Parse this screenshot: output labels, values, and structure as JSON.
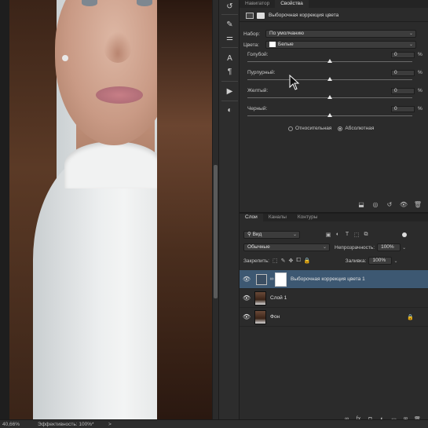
{
  "status_bar": {
    "zoom": "40,66%",
    "efficiency": "Эффективность: 100%*",
    "arrow": ">"
  },
  "tools": [
    {
      "icon": "history-icon",
      "glyph": "↺"
    },
    {
      "icon": "brush-icon",
      "glyph": "✎"
    },
    {
      "icon": "sliders-icon",
      "glyph": "⚌"
    },
    {
      "icon": "type-icon",
      "glyph": "A"
    },
    {
      "icon": "paragraph-icon",
      "glyph": "¶"
    },
    {
      "icon": "play-icon",
      "glyph": "▶"
    },
    {
      "icon": "adjust-icon",
      "glyph": "◐"
    }
  ],
  "properties_panel": {
    "tabs": [
      "Навигатор",
      "Свойства"
    ],
    "active_tab": "Свойства",
    "title": "Выборочная коррекция цвета",
    "preset_label": "Набор:",
    "preset_value": "По умолчанию",
    "colors_label": "Цвета:",
    "colors_value": "Белые",
    "sliders": [
      {
        "label": "Голубой:",
        "value": "0",
        "unit": "%",
        "level": 0.5
      },
      {
        "label": "Пурпурный:",
        "value": "0",
        "unit": "%",
        "level": 0.5
      },
      {
        "label": "Желтый:",
        "value": "0",
        "unit": "%",
        "level": 0.5
      },
      {
        "label": "Черный:",
        "value": "0",
        "unit": "%",
        "level": 0.5
      }
    ],
    "method_relative": "Относительная",
    "method_absolute": "Абсолютная",
    "selected_method": "Абсолютная"
  },
  "layers_panel": {
    "tabs": [
      "Слои",
      "Каналы",
      "Контуры"
    ],
    "active_tab": "Слои",
    "filter_kind": "Вид",
    "blend_mode": "Обычные",
    "opacity_label": "Непрозрачность:",
    "opacity_value": "100%",
    "lock_label": "Закрепить:",
    "fill_label": "Заливка:",
    "fill_value": "100%",
    "layers": [
      {
        "name": "Выборочная коррекция цвета 1",
        "selected": true,
        "type": "adjustment"
      },
      {
        "name": "Слой 1",
        "selected": false,
        "type": "pixel"
      },
      {
        "name": "Фон",
        "selected": false,
        "type": "background",
        "locked": true
      }
    ]
  },
  "colors": {
    "selection": "#3d5872",
    "panel_bg": "#2b2b2b"
  }
}
